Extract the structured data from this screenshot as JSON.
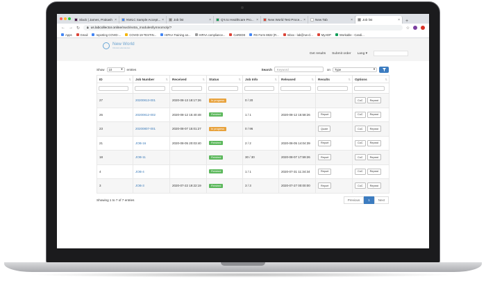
{
  "browser": {
    "tabs": [
      {
        "title": "Slack | James, Prakash",
        "color": "#4a154b",
        "active": false
      },
      {
        "title": "NWLC Sample Accept...",
        "color": "#4285f4",
        "active": false
      },
      {
        "title": "Job list",
        "color": "#888888",
        "active": false
      },
      {
        "title": "Q's to Healthcare Pro...",
        "color": "#0f9d58",
        "active": false
      },
      {
        "title": "New World Test Proce...",
        "color": "#db4437",
        "active": false
      },
      {
        "title": "New Tab",
        "color": "#ffffff",
        "active": false
      },
      {
        "title": "Job list",
        "color": "#888888",
        "active": true
      }
    ],
    "new_tab": "+",
    "url_host": "us.labcollector.online",
    "url_path": "/nwcl/extra_modules/lymnomoly/?",
    "bookmarks": [
      {
        "label": "Apps",
        "color": "#4285f4"
      },
      {
        "label": "Gmail",
        "color": "#db4437"
      },
      {
        "label": "reporting COVID-...",
        "color": "#4285f4"
      },
      {
        "label": "COVID-19 TESTIN...",
        "color": "#f4b400"
      },
      {
        "label": "HIPAA Training an...",
        "color": "#4285f4"
      },
      {
        "label": "HIPAA compliance...",
        "color": "#999999"
      },
      {
        "label": "CaREDE",
        "color": "#db4437"
      },
      {
        "label": "RS Form 8822 (R...",
        "color": "#4285f4"
      },
      {
        "label": "Inbox - lab@nw-cl...",
        "color": "#db4437"
      },
      {
        "label": "MyADP",
        "color": "#db4437"
      },
      {
        "label": "Workable - Candi...",
        "color": "#0f9d58"
      }
    ]
  },
  "app": {
    "logo_title": "New World",
    "logo_sub": "Clinical Laboratories",
    "nav": [
      "Get results",
      "Submit order",
      "Lang ▾"
    ]
  },
  "controls": {
    "show_label": "Show",
    "show_value": "10",
    "entries_label": "entries",
    "search_label": "Search",
    "search_placeholder": "Keyword",
    "on_label": "on",
    "type_value": "Type"
  },
  "table": {
    "headers": [
      "ID",
      "Job Number",
      "Received",
      "Status",
      "Job Info",
      "Released",
      "Results",
      "Options"
    ],
    "rows": [
      {
        "id": "27",
        "job": "20200813-001",
        "received": "2020-08-13 18:17:26",
        "status": "In progress",
        "info": "0 / 20",
        "released": "",
        "result": "",
        "options": [
          "CoC",
          "Repeat"
        ]
      },
      {
        "id": "26",
        "job": "20200812-002",
        "received": "2020-08-12 15:40:48",
        "status": "Finished",
        "info": "1 / 1",
        "released": "2020-08-12 15:58:26",
        "result": "Report",
        "options": [
          "CoC",
          "Repeat"
        ]
      },
      {
        "id": "23",
        "job": "20200807-001",
        "received": "2020-08-07 15:01:27",
        "status": "In progress",
        "info": "0 / 96",
        "released": "",
        "result": "Quote",
        "options": [
          "CoC",
          "Repeat"
        ]
      },
      {
        "id": "21",
        "job": "JOB-16",
        "received": "2020-08-05 20:03:40",
        "status": "Finished",
        "info": "2 / 2",
        "released": "2020-08-05 14:04:39",
        "result": "Report",
        "options": [
          "CoC",
          "Repeat"
        ]
      },
      {
        "id": "18",
        "job": "JOB-11",
        "received": "",
        "status": "Finished",
        "info": "30 / 30",
        "released": "2020-08-07 17:59:26",
        "result": "Report",
        "options": [
          "CoC",
          "Repeat"
        ]
      },
      {
        "id": "4",
        "job": "JOB-4",
        "received": "",
        "status": "Finished",
        "info": "1 / 1",
        "released": "2020-07-31 11:34:34",
        "result": "Report",
        "options": [
          "CoC",
          "Repeat"
        ]
      },
      {
        "id": "3",
        "job": "JOB-3",
        "received": "2020-07-22 19:22:19",
        "status": "Finished",
        "info": "3 / 3",
        "released": "2020-07-27 00:00:00",
        "result": "Report",
        "options": [
          "CoC",
          "Repeat"
        ]
      }
    ]
  },
  "footer": {
    "showing": "Showing 1 to 7 of 7 entries",
    "previous": "Previous",
    "page": "1",
    "next": "Next"
  },
  "colors": {
    "in_progress": "#e8a23c",
    "finished": "#5cb85c",
    "link": "#3a7ab8",
    "primary": "#3c7cc0"
  }
}
